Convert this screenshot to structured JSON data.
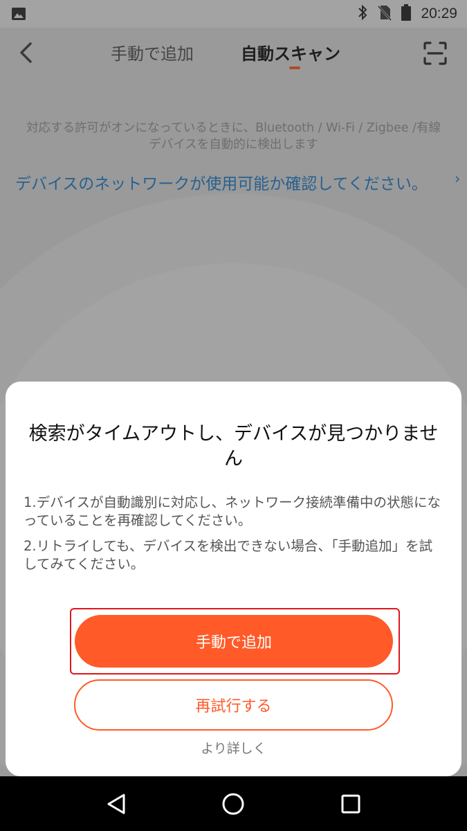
{
  "status_bar": {
    "time": "20:29",
    "icons": [
      "image-icon",
      "bluetooth-icon",
      "no-sim-icon",
      "battery-icon"
    ]
  },
  "top_bar": {
    "tabs": [
      {
        "label": "手動で追加",
        "active": false
      },
      {
        "label": "自動スキャン",
        "active": true
      }
    ],
    "icons": [
      "back-arrow-icon",
      "scan-frame-icon"
    ]
  },
  "content": {
    "description_line1": "対応する許可がオンになっているときに、Bluetooth / Wi-Fi / Zigbee /有線",
    "description_line2": "デバイスを自動的に検出します",
    "network_link": "デバイスのネットワークが使用可能か確認してください。",
    "network_link_chevron": "›"
  },
  "dialog": {
    "title": "検索がタイムアウトし、デバイスが見つかりません",
    "tip1": "1.デバイスが自動識別に対応し、ネットワーク接続準備中の状態になっていることを再確認してください。",
    "tip2": "2.リトライしても、デバイスを検出できない場合、「手動追加」を試してみてください。",
    "primary_button": "手動で追加",
    "secondary_button": "再試行する",
    "more_link": "より詳しく"
  },
  "nav_bar": {
    "icons": [
      "nav-back-icon",
      "nav-home-icon",
      "nav-recent-icon"
    ]
  },
  "colors": {
    "accent": "#ff5a28",
    "link": "#28608f",
    "highlight_border": "#e0161b",
    "overlay_background": "#9a9a9a"
  }
}
